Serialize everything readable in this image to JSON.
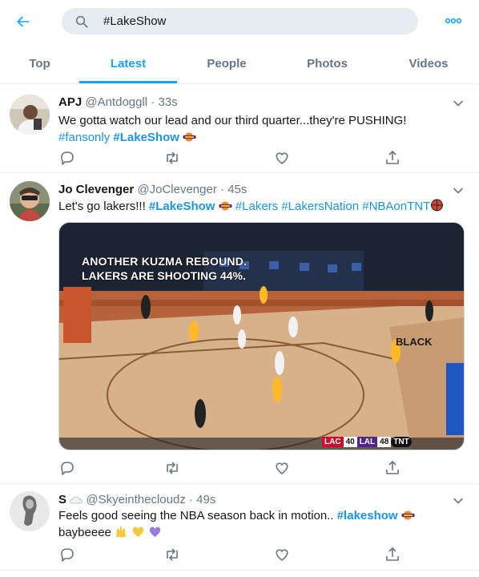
{
  "search": {
    "query": "#LakeShow"
  },
  "icons": {
    "back": "arrow-left-icon",
    "search": "search-icon",
    "more": "more-dots-icon"
  },
  "colors": {
    "accent": "#1da1f2",
    "link": "#1b95e0",
    "muted": "#657786",
    "text": "#14171a",
    "search_bg": "#e6ecf0"
  },
  "tabs": [
    {
      "label": "Top",
      "active": false
    },
    {
      "label": "Latest",
      "active": true
    },
    {
      "label": "People",
      "active": false
    },
    {
      "label": "Photos",
      "active": false
    },
    {
      "label": "Videos",
      "active": false
    }
  ],
  "tweets": [
    {
      "name": "APJ",
      "handle": "@Antdoggll",
      "separator": "·",
      "time": "33s",
      "line1": "We gotta watch our lead and our third quarter...they're PUSHING!",
      "tags": [
        "#fansonly",
        "#LakeShow"
      ]
    },
    {
      "name": "Jo Clevenger",
      "handle": "@JoClevenger",
      "separator": "·",
      "time": "45s",
      "lead": "Let's go lakers!!!",
      "tags": [
        "#LakeShow",
        "#Lakers",
        "#LakersNation",
        "#NBAonTNT"
      ],
      "video": {
        "caption_line1": "ANOTHER KUZMA REBOUND.",
        "caption_line2": "LAKERS ARE SHOOTING 44%.",
        "floor_text": "BLACK",
        "score": {
          "team1": "LAC",
          "score1": "40",
          "team2": "LAL",
          "score2": "48",
          "network": "TNT"
        }
      }
    },
    {
      "name": "S",
      "handle": "@Skyeinthecloudz",
      "separator": "·",
      "time": "49s",
      "lead": "Feels good seeing the NBA season back in motion..",
      "tag": "#lakeshow",
      "line2": "baybeeee"
    }
  ]
}
